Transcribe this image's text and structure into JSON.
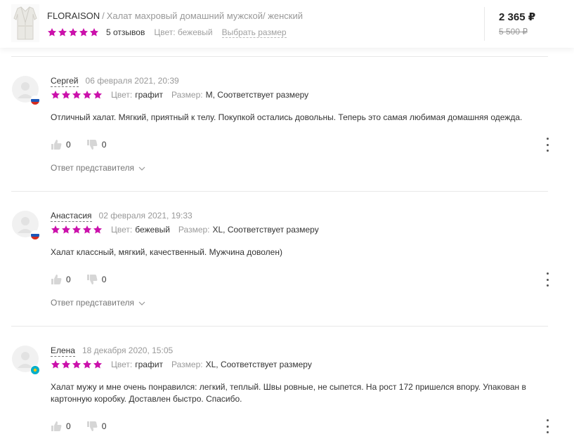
{
  "header": {
    "brand": "FLORAISON",
    "separator": "/",
    "product_name": "Халат махровый домашний мужской/ женский",
    "rating_stars": 5,
    "reviews_count": "5 отзывов",
    "color": "Цвет: бежевый",
    "choose_size": "Выбрать размер",
    "price": "2 365 ₽",
    "old_price": "5 500 ₽"
  },
  "colors": {
    "star": "#cb11ab",
    "muted_text": "#999999",
    "divider": "#e8e8e8"
  },
  "reviews": [
    {
      "author": "Сергей",
      "date": "06 февраля 2021, 20:39",
      "rating_stars": 5,
      "color_label": "Цвет:",
      "color_value": "графит",
      "size_label": "Размер:",
      "size_value": "M, Соответствует размеру",
      "text": "Отличный халат. Мягкий, приятный к телу. Покупкой остались довольны. Теперь это самая любимая домашняя одежда.",
      "likes": "0",
      "dislikes": "0",
      "answer_label": "Ответ представителя",
      "flag": "russia-flag-icon"
    },
    {
      "author": "Анастасия",
      "date": "02 февраля 2021, 19:33",
      "rating_stars": 5,
      "color_label": "Цвет:",
      "color_value": "бежевый",
      "size_label": "Размер:",
      "size_value": "XL, Соответствует размеру",
      "text": "Халат классный, мягкий, качественный. Мужчина доволен)",
      "likes": "0",
      "dislikes": "0",
      "answer_label": "Ответ представителя",
      "flag": "russia-flag-icon"
    },
    {
      "author": "Елена",
      "date": "18 декабря 2020, 15:05",
      "rating_stars": 5,
      "color_label": "Цвет:",
      "color_value": "графит",
      "size_label": "Размер:",
      "size_value": "XL, Соответствует размеру",
      "text": "Халат мужу и мне очень понравился: легкий, теплый. Швы ровные, не сыпется. На рост 172 пришелся впору. Упакован в картонную коробку. Доставлен быстро. Спасибо.",
      "likes": "0",
      "dislikes": "0",
      "flag": "kazakhstan-flag-icon"
    }
  ]
}
